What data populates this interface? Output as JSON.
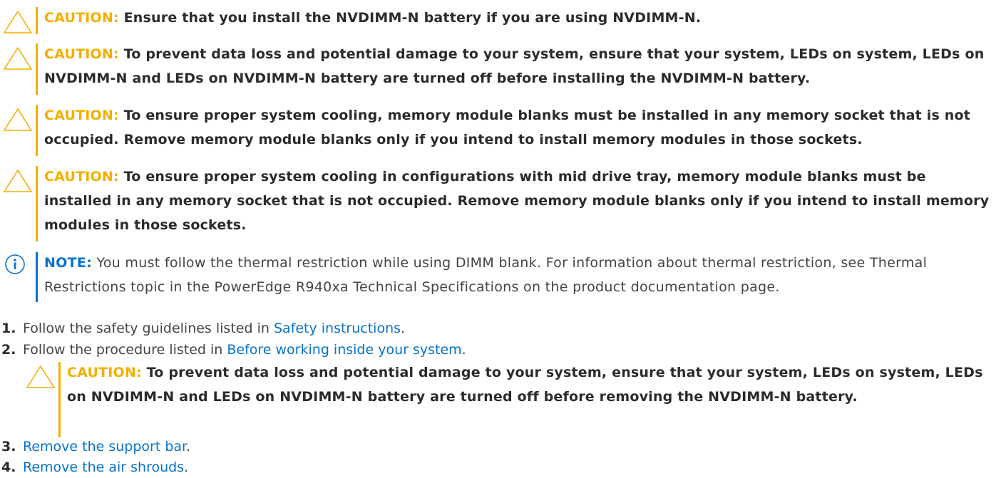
{
  "colors": {
    "caution": "#f2af00",
    "note": "#0672cb",
    "text": "#2b2b2b",
    "link": "#0672cb"
  },
  "icons": {
    "caution": "warning-triangle-icon",
    "note": "info-circle-icon"
  },
  "cautions": [
    {
      "label": "CAUTION:",
      "text": "Ensure that you install the NVDIMM-N battery if you are using NVDIMM-N."
    },
    {
      "label": "CAUTION:",
      "text": "To prevent data loss and potential damage to your system, ensure that your system, LEDs on system, LEDs on NVDIMM-N and LEDs on NVDIMM-N battery are turned off before installing the NVDIMM-N battery."
    },
    {
      "label": "CAUTION:",
      "text": "To ensure proper system cooling, memory module blanks must be installed in any memory socket that is not occupied. Remove memory module blanks only if you intend to install memory modules in those sockets."
    },
    {
      "label": "CAUTION:",
      "text": "To ensure proper system cooling in configurations with mid drive tray, memory module blanks must be installed in any memory socket that is not occupied. Remove memory module blanks only if you intend to install memory modules in those sockets."
    }
  ],
  "note": {
    "label": "NOTE:",
    "text": "You must follow the thermal restriction while using DIMM blank. For information about thermal restriction, see Thermal Restrictions topic in the PowerEdge R940xa Technical Specifications on the product documentation page."
  },
  "steps": [
    {
      "num": "1.",
      "prefix": "Follow the safety guidelines listed in ",
      "link": "Safety instructions",
      "suffix": "."
    },
    {
      "num": "2.",
      "prefix": "Follow the procedure listed in ",
      "link": "Before working inside your system",
      "suffix": "."
    },
    {
      "num": "3.",
      "prefix": "",
      "link": "Remove the support bar",
      "suffix": "."
    },
    {
      "num": "4.",
      "prefix": "",
      "link": "Remove the air shrouds",
      "suffix": "."
    }
  ],
  "step2_caution": {
    "label": "CAUTION:",
    "text": "To prevent data loss and potential damage to your system, ensure that your system, LEDs on system, LEDs on NVDIMM-N and LEDs on NVDIMM-N battery are turned off before removing the NVDIMM-N battery."
  }
}
